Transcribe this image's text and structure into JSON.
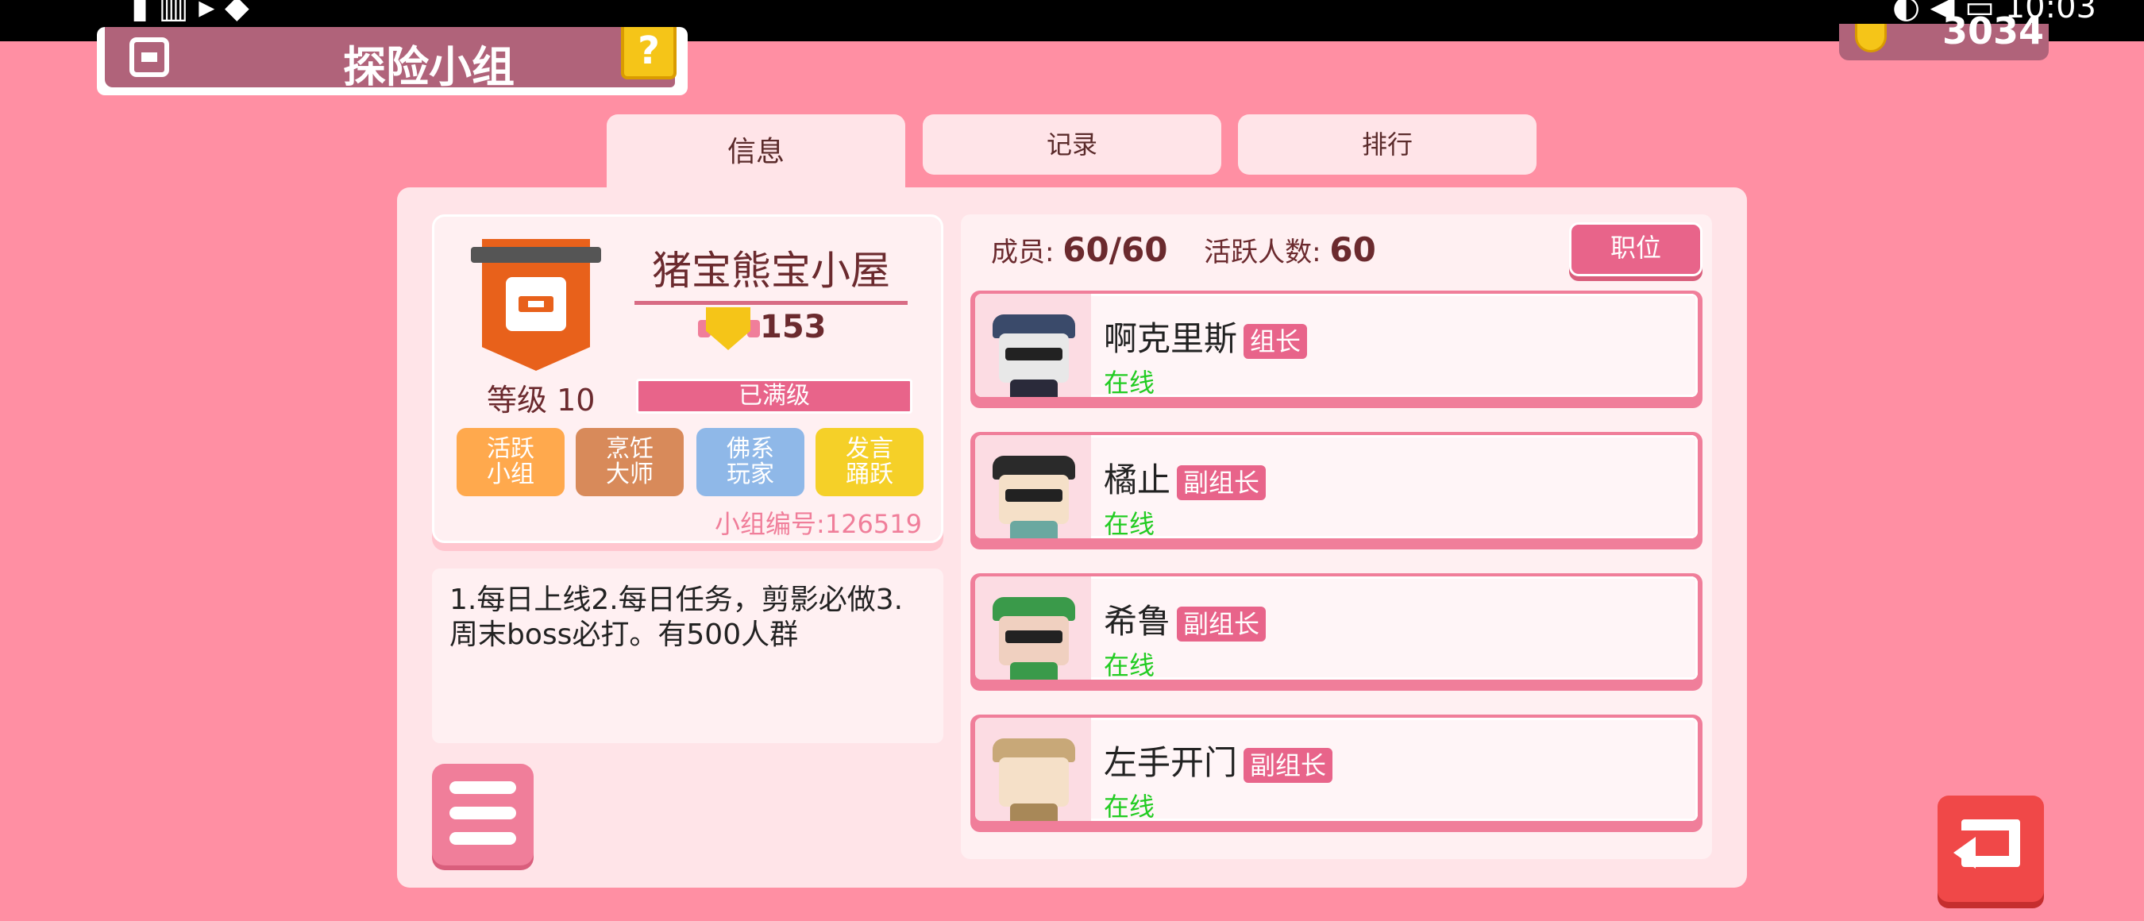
{
  "header": {
    "title": "探险小组",
    "help_label": "?",
    "currency_amount": "3034"
  },
  "tabs": [
    {
      "label": "信息",
      "active": true
    },
    {
      "label": "记录",
      "active": false
    },
    {
      "label": "排行",
      "active": false
    }
  ],
  "group": {
    "name": "猪宝熊宝小屋",
    "trophy_value": "153",
    "level_label": "等级 10",
    "level_status": "已满级",
    "tags": [
      "活跃小组",
      "烹饪大师",
      "佛系玩家",
      "发言踊跃"
    ],
    "group_id": "小组编号:126519",
    "description": "1.每日上线2.每日任务，剪影必做3.周末boss必打。有500人群"
  },
  "members": {
    "count_label": "成员:",
    "count_value": "60/60",
    "active_label": "活跃人数:",
    "active_value": "60",
    "role_button": "职位",
    "list": [
      {
        "name": "啊克里斯",
        "role": "组长",
        "status": "在线"
      },
      {
        "name": "橘止",
        "role": "副组长",
        "status": "在线"
      },
      {
        "name": "希鲁",
        "role": "副组长",
        "status": "在线"
      },
      {
        "name": "左手开门",
        "role": "副组长",
        "status": "在线"
      }
    ]
  },
  "colors": {
    "background": "#ff8fa3",
    "accent": "#e8648a",
    "online": "#22cc22",
    "back_button": "#f04848"
  }
}
